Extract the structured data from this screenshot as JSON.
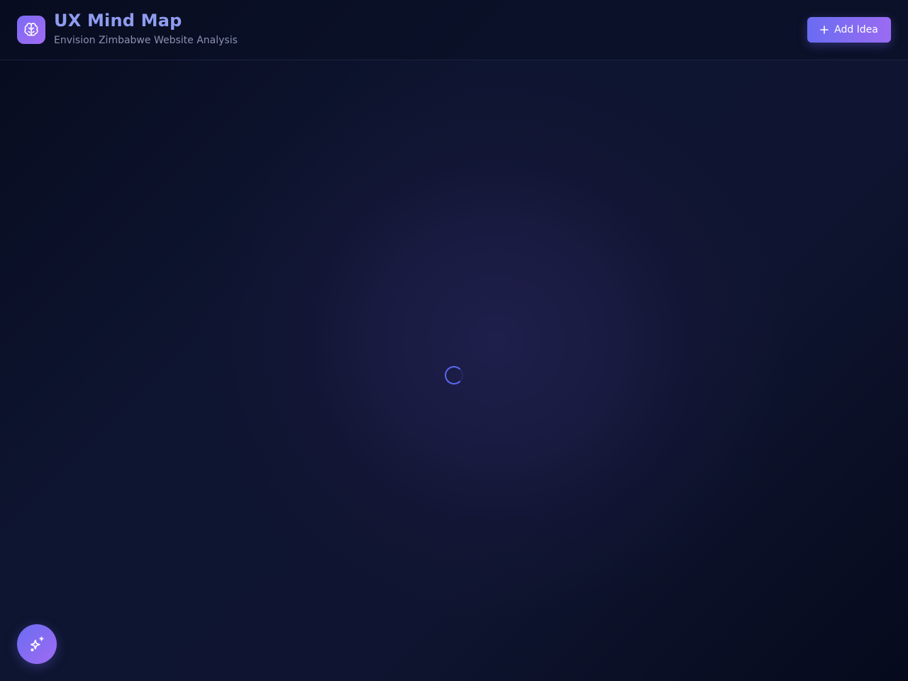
{
  "header": {
    "logo_icon": "brain-icon",
    "title": "UX Mind Map",
    "subtitle": "Envision Zimbabwe Website Analysis",
    "add_button": {
      "label": "Add Idea",
      "icon": "plus-icon"
    }
  },
  "main": {
    "loading_indicator": "spinner-icon"
  },
  "fab": {
    "icon": "sparkles-icon"
  },
  "colors": {
    "accent_start": "#6a6cf2",
    "accent_end": "#a06bf2",
    "title": "#8f9cf0",
    "subtitle": "#8b91b2",
    "background": "#0b1024",
    "spinner": "#5a69f0"
  }
}
